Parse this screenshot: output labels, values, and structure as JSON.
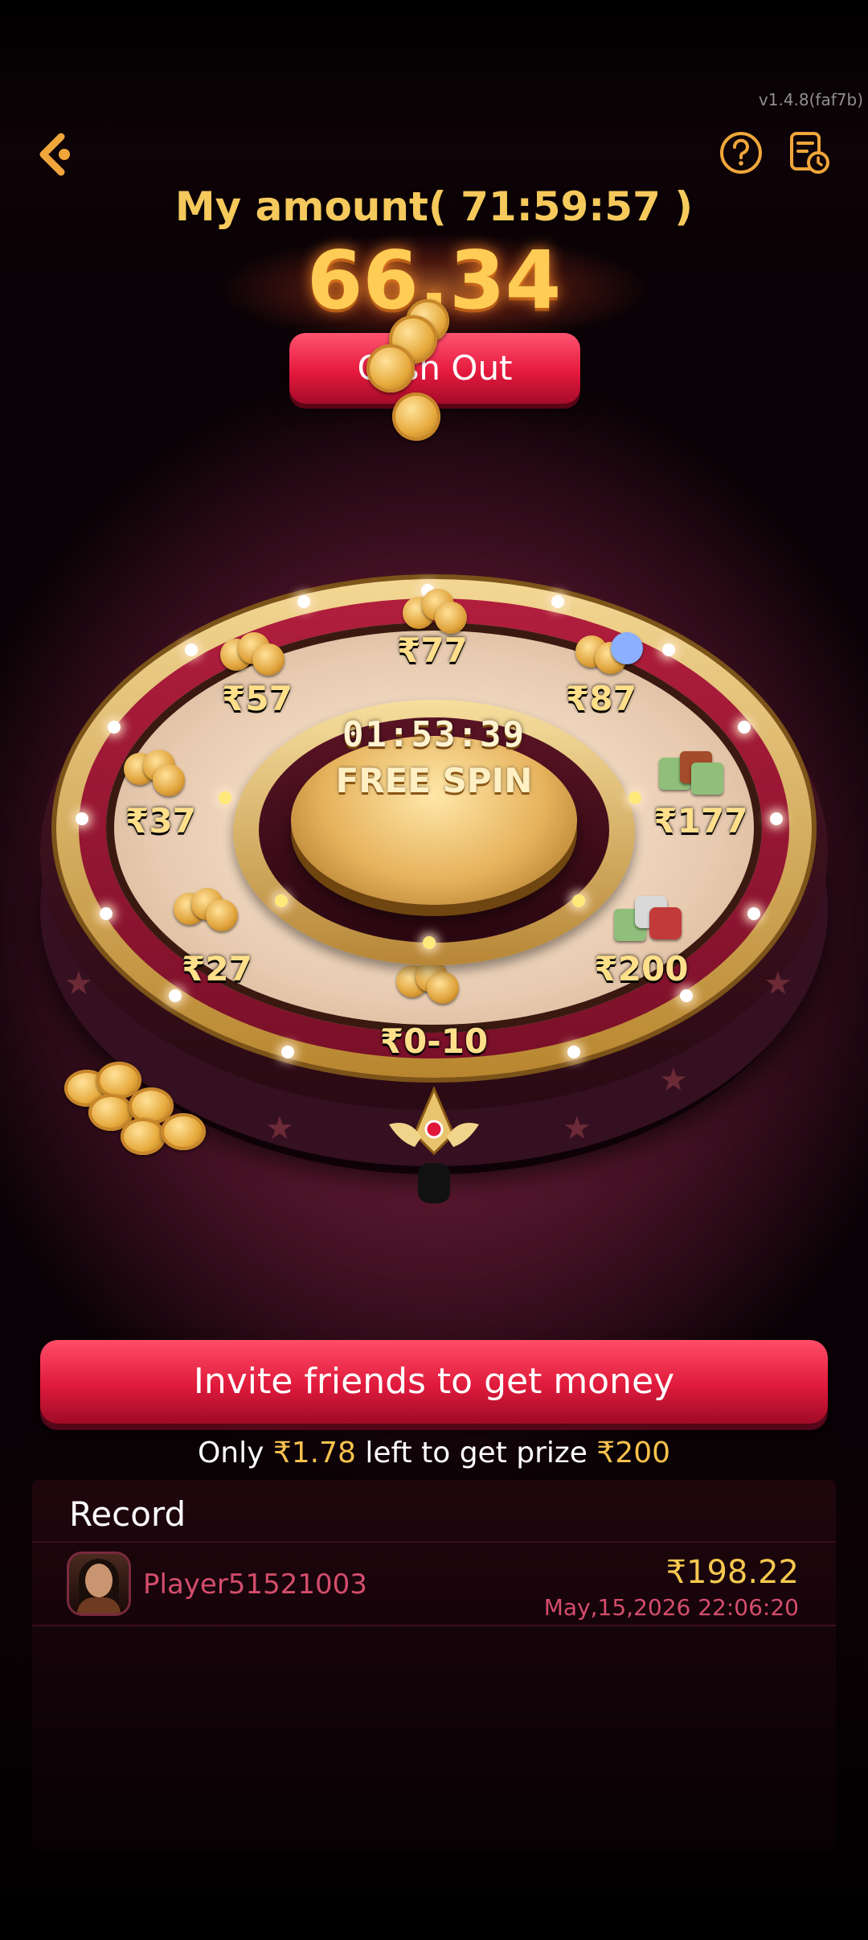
{
  "app": {
    "version": "v1.4.8(faf7b)"
  },
  "header": {
    "amount_title": "My amount(  71:59:57  )",
    "amount_value": "66.34",
    "cashout_label": "Cash Out"
  },
  "wheel": {
    "timer": "01:53:39",
    "spin_label": "FREE SPIN",
    "prizes": {
      "p77": "₹77",
      "p87": "₹87",
      "p177": "₹177",
      "p200": "₹200",
      "p0_10": "₹0-10",
      "p27": "₹27",
      "p37": "₹37",
      "p57": "₹57"
    }
  },
  "invite": {
    "button_label": "Invite friends to get money",
    "progress_prefix": "Only ",
    "progress_left": "₹1.78",
    "progress_middle": " left to get prize ",
    "progress_prize": "₹200"
  },
  "record": {
    "title": "Record",
    "rows": [
      {
        "player": "Player51521003",
        "amount": "₹198.22",
        "time": "May,15,2026 22:06:20"
      }
    ]
  },
  "colors": {
    "accent_red": "#e5193e",
    "gold": "#f6c95c",
    "pink_text": "#d44d6c"
  }
}
